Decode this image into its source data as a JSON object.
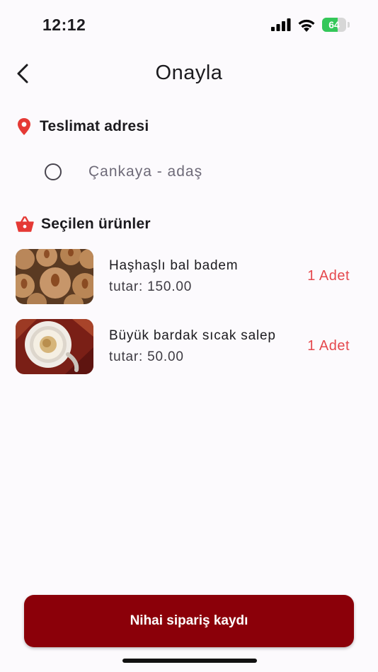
{
  "status_bar": {
    "time": "12:12",
    "battery": "64",
    "battery_level": 0.64
  },
  "header": {
    "title": "Onayla"
  },
  "delivery": {
    "heading": "Teslimat adresi",
    "address": "Çankaya - adaş"
  },
  "products": {
    "heading": "Seçilen ürünler",
    "items": [
      {
        "name": "Haşhaşlı bal badem",
        "price": "tutar: 150.00",
        "qty": "1 Adet",
        "icon": "almond-cookie-image"
      },
      {
        "name": "Büyük bardak sıcak salep",
        "price": "tutar: 50.00",
        "qty": "1 Adet",
        "icon": "salep-cup-image"
      }
    ]
  },
  "submit": {
    "label": "Nihai sipariş kaydı"
  },
  "colors": {
    "accent": "#8b0009",
    "quantity": "#e5484d",
    "icon_red": "#e53935",
    "background": "#fcfafd"
  }
}
